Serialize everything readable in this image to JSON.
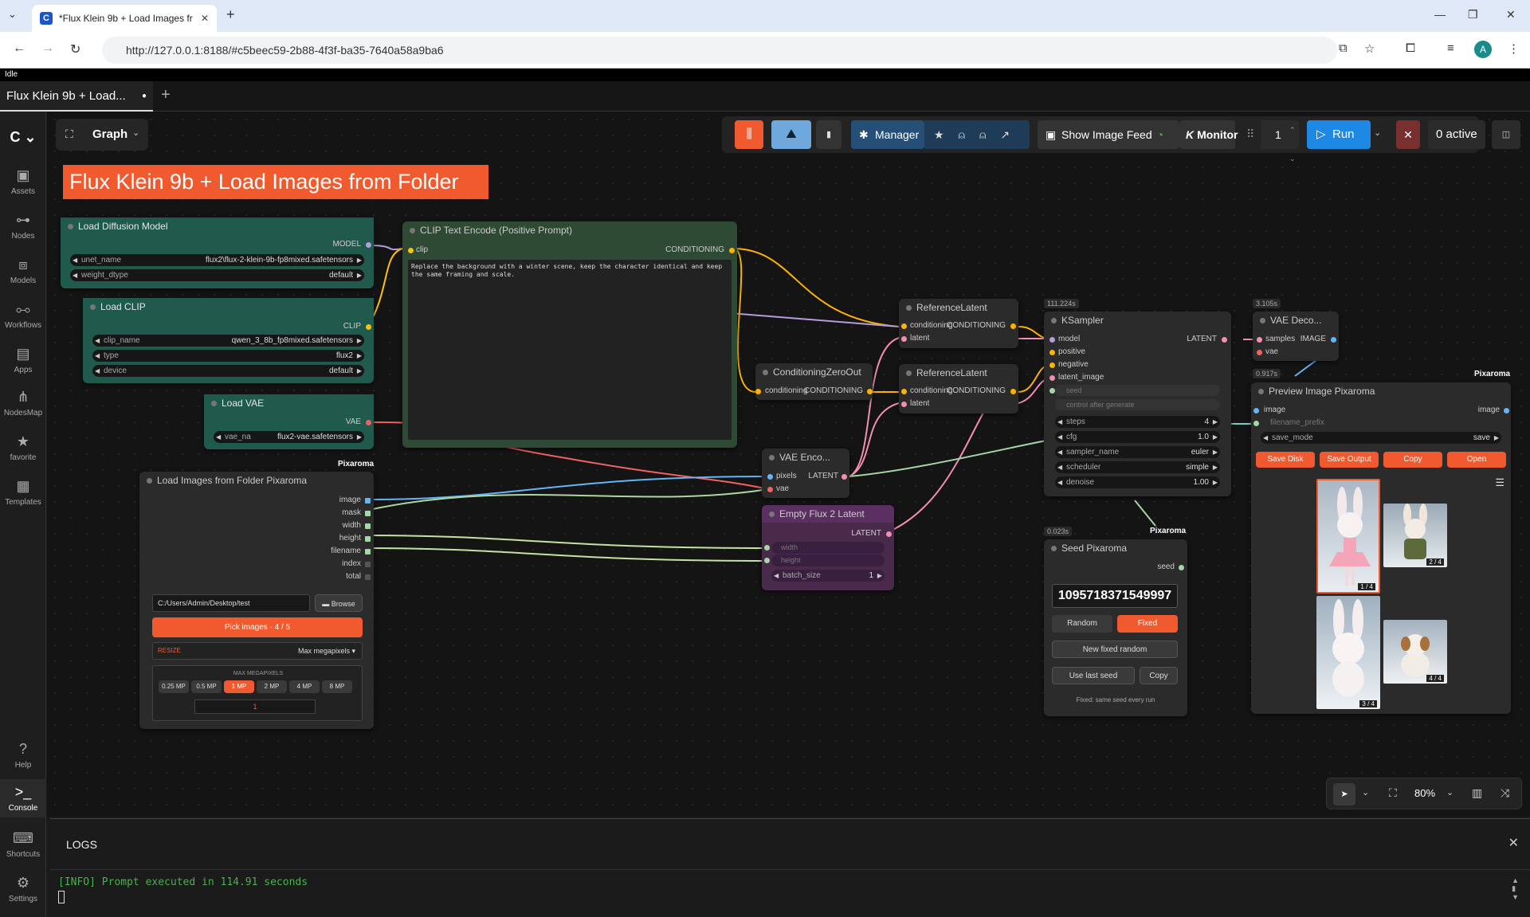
{
  "browser": {
    "tab_title": "*Flux Klein 9b + Load Images fr",
    "url": "http://127.0.0.1:8188/#c5beec59-2b88-4f3f-ba35-7640a58a9ba6",
    "avatar": "A"
  },
  "status": "Idle",
  "workflow_tab": "Flux Klein 9b + Load...",
  "header": {
    "graph_label": "Graph",
    "manager": "Manager",
    "show_image_feed": "Show Image Feed",
    "monitor": "Monitor",
    "queue_count": "1",
    "run": "Run",
    "active": "0 active"
  },
  "sidebar": [
    "Assets",
    "Nodes",
    "Models",
    "Workflows",
    "Apps",
    "NodesMap",
    "favorite",
    "Templates",
    "Help",
    "Console",
    "Shortcuts",
    "Settings"
  ],
  "group_title": "Flux Klein 9b + Load Images from Folder",
  "nodes": {
    "diffusion": {
      "title": "Load Diffusion Model",
      "out": "MODEL",
      "unet_label": "unet_name",
      "unet_value": "flux2\\flux-2-klein-9b-fp8mixed.safetensors",
      "wd_label": "weight_dtype",
      "wd_value": "default"
    },
    "clip": {
      "title": "Load CLIP",
      "out": "CLIP",
      "name_label": "clip_name",
      "name_value": "qwen_3_8b_fp8mixed.safetensors",
      "type_label": "type",
      "type_value": "flux2",
      "device_label": "device",
      "device_value": "default"
    },
    "vae": {
      "title": "Load VAE",
      "out": "VAE",
      "label": "vae_na",
      "value": "flux2-vae.safetensors"
    },
    "encode": {
      "title": "CLIP Text Encode (Positive Prompt)",
      "in": "clip",
      "out": "CONDITIONING",
      "prompt": "Replace the background with a winter scene, keep the character identical and keep the same framing and scale."
    },
    "folder": {
      "brand": "Pixaroma",
      "title": "Load Images from Folder Pixaroma",
      "outs": [
        "image",
        "mask",
        "width",
        "height",
        "filename",
        "index",
        "total"
      ],
      "path": "C:/Users/Admin/Desktop/test",
      "browse": "Browse",
      "pick": "Pick images · 4 / 5",
      "resize": "RESIZE",
      "resize_mode": "Max megapixels ▾",
      "mp_title": "MAX MEGAPIXELS",
      "mp": [
        "0.25 MP",
        "0.5 MP",
        "1 MP",
        "2 MP",
        "4 MP",
        "8 MP"
      ],
      "mp_val": "1"
    },
    "zero": {
      "title": "ConditioningZeroOut",
      "in": "conditioning",
      "out": "CONDITIONING"
    },
    "ref1": {
      "title": "ReferenceLatent",
      "in1": "conditioning",
      "in2": "latent",
      "out": "CONDITIONING"
    },
    "ref2": {
      "title": "ReferenceLatent",
      "in1": "conditioning",
      "in2": "latent",
      "out": "CONDITIONING"
    },
    "vaeenc": {
      "title": "VAE Enco...",
      "in1": "pixels",
      "in2": "vae",
      "out": "LATENT"
    },
    "empty": {
      "title": "Empty Flux 2 Latent",
      "out": "LATENT",
      "w": "width",
      "h": "height",
      "bs_label": "batch_size",
      "bs_value": "1"
    },
    "ksampler": {
      "time": "111.224s",
      "title": "KSampler",
      "ins": [
        "model",
        "positive",
        "negative",
        "latent_image"
      ],
      "out": "LATENT",
      "seed": "seed",
      "cag": "control after generate",
      "steps_l": "steps",
      "steps_v": "4",
      "cfg_l": "cfg",
      "cfg_v": "1.0",
      "sampler_l": "sampler_name",
      "sampler_v": "euler",
      "sched_l": "scheduler",
      "sched_v": "simple",
      "denoise_l": "denoise",
      "denoise_v": "1.00"
    },
    "vaedec": {
      "time": "3.105s",
      "title": "VAE Deco...",
      "in1": "samples",
      "in2": "vae",
      "out": "IMAGE"
    },
    "seed": {
      "time": "0.023s",
      "brand": "Pixaroma",
      "title": "Seed Pixaroma",
      "out": "seed",
      "value": "1095718371549997",
      "random": "Random",
      "fixed": "Fixed",
      "newfixed": "New fixed random",
      "uselast": "Use last seed",
      "copy": "Copy",
      "note": "Fixed: same seed every run"
    },
    "preview": {
      "time": "0.917s",
      "brand": "Pixaroma",
      "title": "Preview Image Pixaroma",
      "in": "image",
      "out": "image",
      "prefix": "filename_prefix",
      "mode_l": "save_mode",
      "mode_v": "save",
      "b1": "Save Disk",
      "b2": "Save Output",
      "b3": "Copy",
      "b4": "Open",
      "c1": "1 / 4",
      "c2": "2 / 4",
      "c3": "3 / 4",
      "c4": "4 / 4"
    }
  },
  "zoom": "80%",
  "logs": {
    "title": "LOGS",
    "line": "[INFO] Prompt executed in 114.91 seconds"
  }
}
